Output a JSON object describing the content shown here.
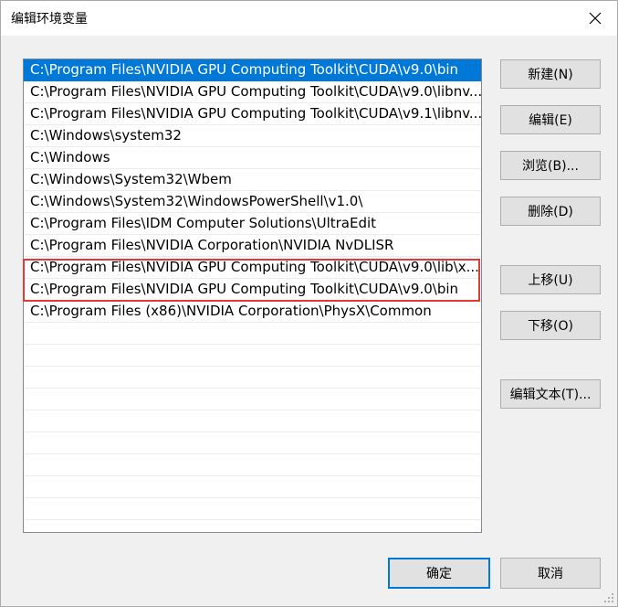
{
  "window": {
    "title": "编辑环境变量"
  },
  "paths": [
    "C:\\Program Files\\NVIDIA GPU Computing Toolkit\\CUDA\\v9.0\\bin",
    "C:\\Program Files\\NVIDIA GPU Computing Toolkit\\CUDA\\v9.0\\libnv...",
    "C:\\Program Files\\NVIDIA GPU Computing Toolkit\\CUDA\\v9.1\\libnv...",
    "C:\\Windows\\system32",
    "C:\\Windows",
    "C:\\Windows\\System32\\Wbem",
    "C:\\Windows\\System32\\WindowsPowerShell\\v1.0\\",
    "C:\\Program Files\\IDM Computer Solutions\\UltraEdit",
    "C:\\Program Files\\NVIDIA Corporation\\NVIDIA NvDLISR",
    "C:\\Program Files\\NVIDIA GPU Computing Toolkit\\CUDA\\v9.0\\lib\\x...",
    "C:\\Program Files\\NVIDIA GPU Computing Toolkit\\CUDA\\v9.0\\bin",
    "C:\\Program Files (x86)\\NVIDIA Corporation\\PhysX\\Common"
  ],
  "buttons": {
    "new": "新建(N)",
    "edit": "编辑(E)",
    "browse": "浏览(B)...",
    "delete": "删除(D)",
    "move_up": "上移(U)",
    "move_down": "下移(O)",
    "edit_text": "编辑文本(T)...",
    "ok": "确定",
    "cancel": "取消"
  },
  "colors": {
    "selection": "#0078d7",
    "highlight_box": "#e53935"
  }
}
